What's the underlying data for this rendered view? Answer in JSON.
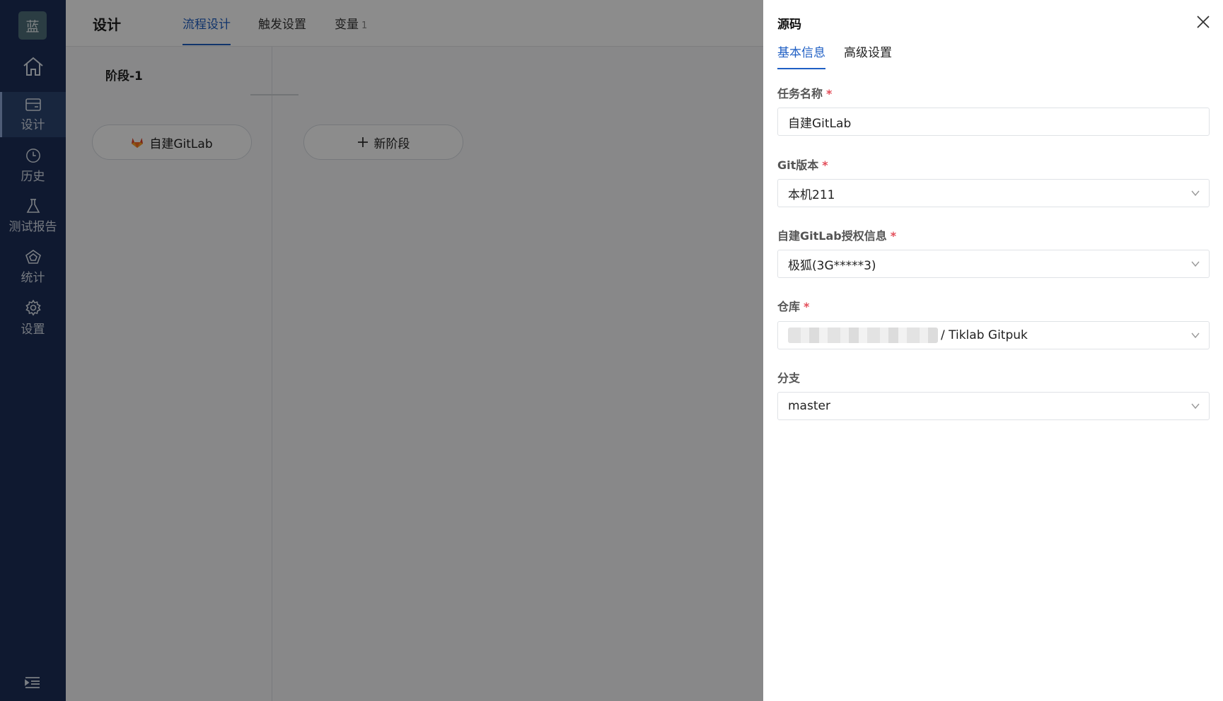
{
  "sidebar": {
    "logo_text": "蓝",
    "items": [
      {
        "label": "设计",
        "icon": "layout-icon",
        "active": true
      },
      {
        "label": "历史",
        "icon": "clock-icon"
      },
      {
        "label": "测试报告",
        "icon": "flask-icon"
      },
      {
        "label": "统计",
        "icon": "pentagon-chart-icon"
      },
      {
        "label": "设置",
        "icon": "gear-icon"
      }
    ],
    "home_icon": "home-icon",
    "collapse_icon": "indent-menu-icon",
    "bg_color": "#1c2f58"
  },
  "header": {
    "title": "设计",
    "tabs": [
      {
        "label": "流程设计",
        "active": true
      },
      {
        "label": "触发设置"
      },
      {
        "label": "变量",
        "count": "1"
      }
    ]
  },
  "canvas": {
    "stage_title": "阶段-1",
    "task_label": "自建GitLab",
    "task_icon": "gitlab-icon",
    "new_stage_label": "新阶段"
  },
  "drawer": {
    "title": "源码",
    "tabs": [
      {
        "label": "基本信息",
        "active": true
      },
      {
        "label": "高级设置"
      }
    ],
    "fields": {
      "task_name": {
        "label": "任务名称",
        "required": true,
        "value": "自建GitLab"
      },
      "git_version": {
        "label": "Git版本",
        "required": true,
        "value": "本机211"
      },
      "auth": {
        "label": "自建GitLab授权信息",
        "required": true,
        "value": "极狐(3G*****3)"
      },
      "repo": {
        "label": "仓库",
        "required": true,
        "value": "/ Tiklab Gitpuk"
      },
      "branch": {
        "label": "分支",
        "required": false,
        "value": "master"
      }
    }
  },
  "colors": {
    "accent": "#1f5fc4",
    "required": "#e34d59"
  }
}
